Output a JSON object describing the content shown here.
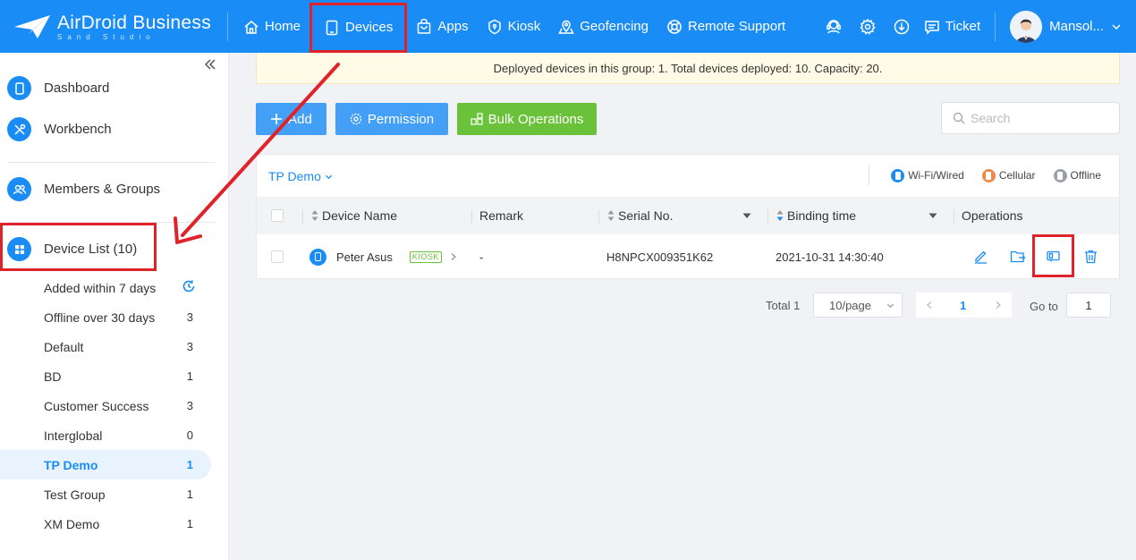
{
  "app": {
    "logo_title": "AirDroid Business",
    "logo_sub": "Sand Studio"
  },
  "nav": {
    "items": [
      {
        "label": "Home",
        "icon": "home-icon"
      },
      {
        "label": "Devices",
        "icon": "tablet-icon"
      },
      {
        "label": "Apps",
        "icon": "bag-icon"
      },
      {
        "label": "Kiosk",
        "icon": "kiosk-icon"
      },
      {
        "label": "Geofencing",
        "icon": "map-pin-icon"
      },
      {
        "label": "Remote Support",
        "icon": "lifebuoy-icon"
      }
    ],
    "active": "Devices",
    "ticket_label": "Ticket",
    "user_name": "Mansol..."
  },
  "sidebar": {
    "dashboard": "Dashboard",
    "workbench": "Workbench",
    "members_groups": "Members & Groups",
    "device_list": "Device List (10)",
    "groups": [
      {
        "name": "Added within 7 days",
        "count": ""
      },
      {
        "name": "Offline over 30 days",
        "count": "3"
      },
      {
        "name": "Default",
        "count": "3"
      },
      {
        "name": "BD",
        "count": "1"
      },
      {
        "name": "Customer Success",
        "count": "3"
      },
      {
        "name": "Interglobal",
        "count": "0"
      },
      {
        "name": "TP Demo",
        "count": "1"
      },
      {
        "name": "Test Group",
        "count": "1"
      },
      {
        "name": "XM Demo",
        "count": "1"
      }
    ],
    "active_group": "TP Demo"
  },
  "notice": "Deployed devices in this group: 1. Total devices deployed: 10. Capacity: 20.",
  "toolbar": {
    "add_label": "Add",
    "permission_label": "Permission",
    "bulk_label": "Bulk Operations",
    "search_placeholder": "Search"
  },
  "table": {
    "group_selector": "TP Demo",
    "legend": [
      {
        "label": "Wi-Fi/Wired",
        "color": "#1a8cf5"
      },
      {
        "label": "Cellular",
        "color": "#f08a4b"
      },
      {
        "label": "Offline",
        "color": "#9aa0a6"
      }
    ],
    "columns": {
      "device_name": "Device Name",
      "remark": "Remark",
      "serial": "Serial No.",
      "binding_time": "Binding time",
      "operations": "Operations"
    },
    "rows": [
      {
        "device_name": "Peter Asus",
        "badge": "KIOSK",
        "remark": "-",
        "serial": "H8NPCX009351K62",
        "binding_time": "2021-10-31 14:30:40"
      }
    ]
  },
  "pagination": {
    "total": "Total 1",
    "page_size": "10/page",
    "current_page": "1",
    "goto_label": "Go to",
    "goto_value": "1"
  },
  "colors": {
    "brand": "#1a8cf5",
    "highlight": "#e0232b",
    "bulk_button": "#6ac23a"
  }
}
